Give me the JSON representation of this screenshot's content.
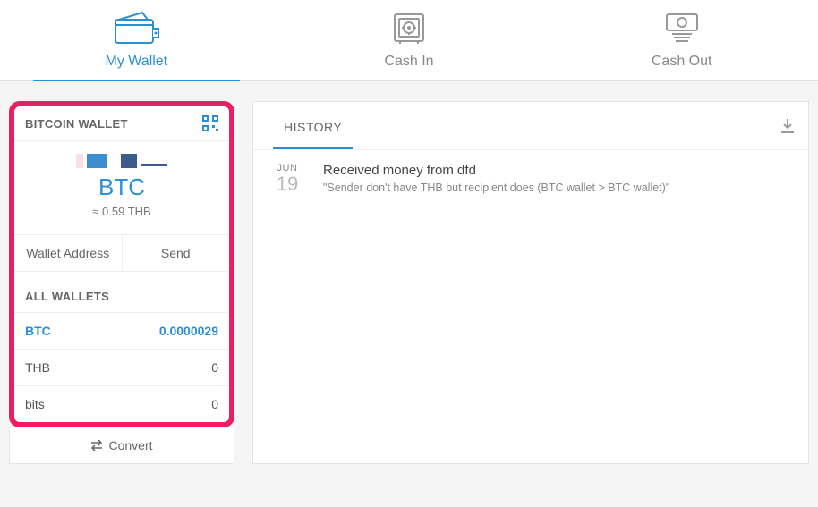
{
  "tabs": {
    "wallet": "My Wallet",
    "cashin": "Cash In",
    "cashout": "Cash Out"
  },
  "wallet_panel": {
    "title": "BITCOIN WALLET",
    "currency": "BTC",
    "approx": "≈ 0.59 THB",
    "address_btn": "Wallet Address",
    "send_btn": "Send"
  },
  "all_wallets": {
    "title": "ALL WALLETS",
    "rows": [
      {
        "name": "BTC",
        "amount": "0.0000029",
        "active": true
      },
      {
        "name": "THB",
        "amount": "0",
        "active": false
      },
      {
        "name": "bits",
        "amount": "0",
        "active": false
      }
    ]
  },
  "convert_label": "Convert",
  "history": {
    "tab": "HISTORY",
    "entries": [
      {
        "month": "JUN",
        "day": "19",
        "title": "Received money from dfd",
        "sub": "\"Sender don't have THB but recipient does (BTC wallet > BTC wallet)\""
      }
    ]
  }
}
